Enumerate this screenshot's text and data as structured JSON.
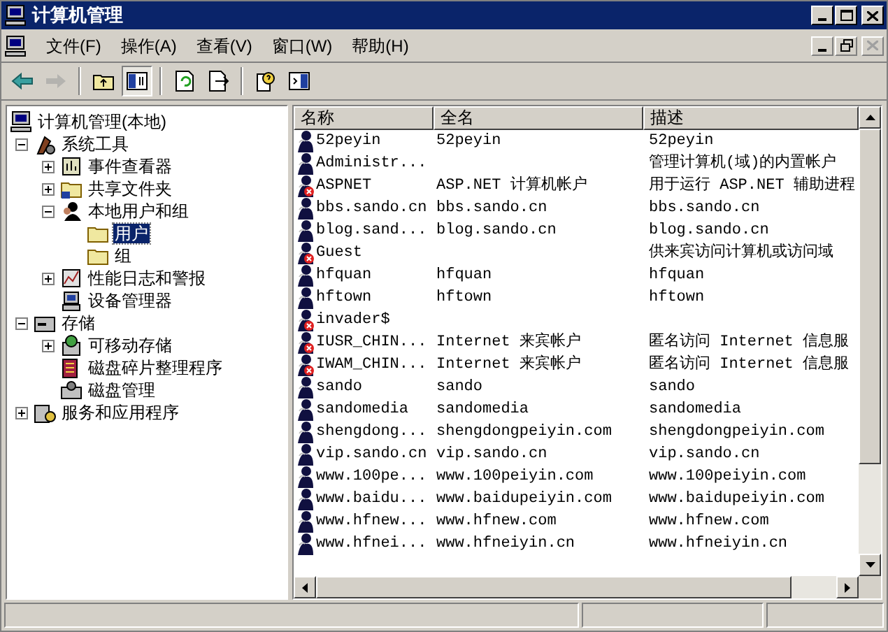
{
  "window": {
    "title": "计算机管理"
  },
  "menu": [
    "文件(F)",
    "操作(A)",
    "查看(V)",
    "窗口(W)",
    "帮助(H)"
  ],
  "toolbar": [
    {
      "pressed": false,
      "disabled": false
    },
    {
      "pressed": false,
      "disabled": true
    },
    {
      "pressed": false,
      "disabled": false
    },
    {
      "pressed": true,
      "disabled": false
    },
    {
      "pressed": false,
      "disabled": false
    },
    {
      "pressed": false,
      "disabled": false
    },
    {
      "pressed": false,
      "disabled": false
    },
    {
      "pressed": false,
      "disabled": false
    }
  ],
  "tree": [
    {
      "label": "计算机管理(本地)",
      "selected": false,
      "children": [
        {
          "label": "系统工具",
          "selected": false,
          "expanded": true,
          "children": [
            {
              "label": "事件查看器",
              "selected": false,
              "expanded": false
            },
            {
              "label": "共享文件夹",
              "selected": false,
              "expanded": false
            },
            {
              "label": "本地用户和组",
              "selected": false,
              "expanded": true,
              "children": [
                {
                  "label": "用户",
                  "selected": true
                },
                {
                  "label": "组",
                  "selected": false
                }
              ]
            },
            {
              "label": "性能日志和警报",
              "selected": false,
              "expanded": false
            },
            {
              "label": "设备管理器",
              "selected": false
            }
          ]
        },
        {
          "label": "存储",
          "selected": false,
          "expanded": true,
          "children": [
            {
              "label": "可移动存储",
              "selected": false,
              "expanded": false
            },
            {
              "label": "磁盘碎片整理程序",
              "selected": false
            },
            {
              "label": "磁盘管理",
              "selected": false
            }
          ]
        },
        {
          "label": "服务和应用程序",
          "selected": false,
          "expanded": false
        }
      ]
    }
  ],
  "table": {
    "columns": [
      "名称",
      "全名",
      "描述"
    ],
    "rows": [
      {
        "name": "52peyin",
        "full_name": "52peyin",
        "description": "52peyin",
        "disabled": false
      },
      {
        "name": "Administr...",
        "description": "管理计算机(域)的内置帐户",
        "disabled": false
      },
      {
        "name": "ASPNET",
        "full_name": "ASP.NET 计算机帐户",
        "description": "用于运行 ASP.NET 辅助进程",
        "disabled": true
      },
      {
        "name": "bbs.sando.cn",
        "full_name": "bbs.sando.cn",
        "description": "bbs.sando.cn",
        "disabled": false
      },
      {
        "name": "blog.sand...",
        "full_name": "blog.sando.cn",
        "description": "blog.sando.cn",
        "disabled": false
      },
      {
        "name": "Guest",
        "description": "供来宾访问计算机或访问域",
        "disabled": true
      },
      {
        "name": "hfquan",
        "full_name": "hfquan",
        "description": "hfquan",
        "disabled": false
      },
      {
        "name": "hftown",
        "full_name": "hftown",
        "description": "hftown",
        "disabled": false
      },
      {
        "name": "invader$",
        "disabled": true
      },
      {
        "name": "IUSR_CHIN...",
        "full_name": "Internet 来宾帐户",
        "description": "匿名访问 Internet 信息服",
        "disabled": true
      },
      {
        "name": "IWAM_CHIN...",
        "full_name": "Internet 来宾帐户",
        "description": "匿名访问 Internet 信息服",
        "disabled": true
      },
      {
        "name": "sando",
        "full_name": "sando",
        "description": "sando",
        "disabled": false
      },
      {
        "name": "sandomedia",
        "full_name": "sandomedia",
        "description": "sandomedia",
        "disabled": false
      },
      {
        "name": "shengdong...",
        "full_name": "shengdongpeiyin.com",
        "description": "shengdongpeiyin.com",
        "disabled": false
      },
      {
        "name": "vip.sando.cn",
        "full_name": "vip.sando.cn",
        "description": "vip.sando.cn",
        "disabled": false
      },
      {
        "name": "www.100pe...",
        "full_name": "www.100peiyin.com",
        "description": "www.100peiyin.com",
        "disabled": false
      },
      {
        "name": "www.baidu...",
        "full_name": "www.baidupeiyin.com",
        "description": "www.baidupeiyin.com",
        "disabled": false
      },
      {
        "name": "www.hfnew...",
        "full_name": "www.hfnew.com",
        "description": "www.hfnew.com",
        "disabled": false
      },
      {
        "name": "www.hfnei...",
        "full_name": "www.hfneiyin.cn",
        "description": "www.hfneiyin.cn",
        "disabled": false
      }
    ]
  }
}
